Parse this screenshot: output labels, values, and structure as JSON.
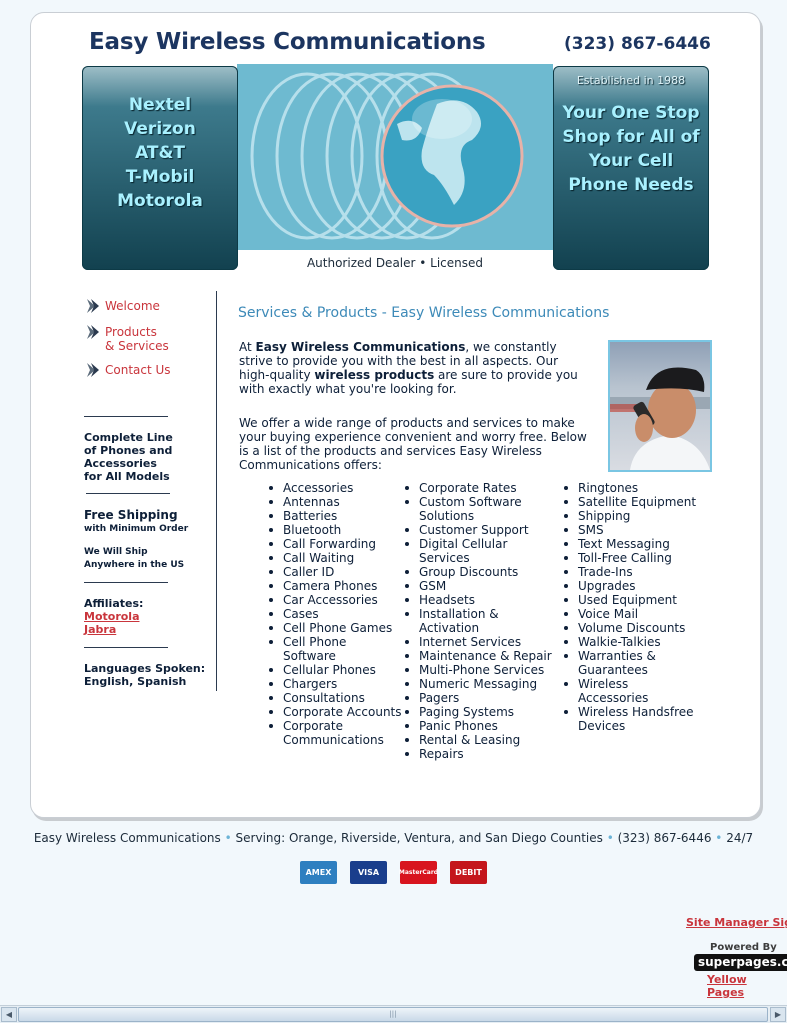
{
  "header": {
    "title": "Easy Wireless Communications",
    "phone": "(323) 867-6446"
  },
  "banner": {
    "brands": [
      "Nextel",
      "Verizon",
      "AT&T",
      "T-Mobil",
      "Motorola"
    ],
    "established": "Established in 1988",
    "slogan": "Your One Stop Shop for All of Your Cell Phone Needs",
    "dealer": "Authorized Dealer • Licensed"
  },
  "nav": {
    "items": [
      {
        "label_1": "Welcome",
        "label_2": ""
      },
      {
        "label_1": "Products",
        "label_2": "& Services"
      },
      {
        "label_1": "Contact Us",
        "label_2": ""
      }
    ]
  },
  "sidebar": {
    "complete_line": [
      "Complete Line",
      "of Phones and",
      "Accessories",
      "for All Models"
    ],
    "shipping_title": "Free Shipping",
    "shipping_sub": "with Minimum Order",
    "ship_1": "We Will Ship",
    "ship_2": "Anywhere in the US",
    "affiliates_title": "Affiliates:",
    "affiliates": [
      "Motorola",
      "Jabra"
    ],
    "languages_title": "Languages Spoken:",
    "languages": "English, Spanish"
  },
  "content": {
    "title": "Services & Products - Easy Wireless Communications",
    "p1_a": "At ",
    "p1_b": "Easy Wireless Communications",
    "p1_c": ", we constantly strive to provide you with the best in all aspects. Our high-quality ",
    "p1_d": "wireless products",
    "p1_e": " are sure to provide you with exactly what you're looking for.",
    "p2": "We offer a wide range of products and services to make your buying experience convenient and worry free. Below is a list of the products and services Easy Wireless Communications offers:",
    "col1": [
      "Accessories",
      "Antennas",
      "Batteries",
      "Bluetooth",
      "Call Forwarding",
      "Call Waiting",
      "Caller ID",
      "Camera Phones",
      "Car Accessories",
      "Cases",
      "Cell Phone Games",
      "Cell Phone Software",
      "Cellular Phones",
      "Chargers",
      "Consultations",
      "Corporate Accounts",
      "Corporate Communications"
    ],
    "col2": [
      "Corporate Rates",
      "Custom Software Solutions",
      "Customer Support",
      "Digital Cellular Services",
      "Group Discounts",
      "GSM",
      "Headsets",
      "Installation & Activation",
      "Internet Services",
      "Maintenance & Repair",
      "Multi-Phone Services",
      "Numeric Messaging",
      "Pagers",
      "Paging Systems",
      "Panic Phones",
      "Rental & Leasing",
      "Repairs"
    ],
    "col3": [
      "Ringtones",
      "Satellite Equipment",
      "Shipping",
      "SMS",
      "Text Messaging",
      "Toll-Free Calling",
      "Trade-Ins",
      "Upgrades",
      "Used Equipment",
      "Voice Mail",
      "Volume Discounts",
      "Walkie-Talkies",
      "Warranties & Guarantees",
      "Wireless Accessories",
      "Wireless Handsfree Devices"
    ]
  },
  "footer": {
    "name": "Easy Wireless Communications",
    "serving": "Serving: Orange, Riverside, Ventura, and San Diego Counties",
    "phone": "(323) 867-6446",
    "hours": "24/7",
    "cards": [
      "AMEX",
      "VISA",
      "MasterCard",
      "DEBIT"
    ],
    "card_colors": [
      "#2e7fc0",
      "#1a3e8c",
      "#d8141e",
      "#c4161c"
    ]
  },
  "bottom": {
    "site_manager": "Site Manager Sign",
    "powered_by": "Powered By",
    "logo": "superpages.com",
    "yellow_pages": "Yellow Pages"
  }
}
